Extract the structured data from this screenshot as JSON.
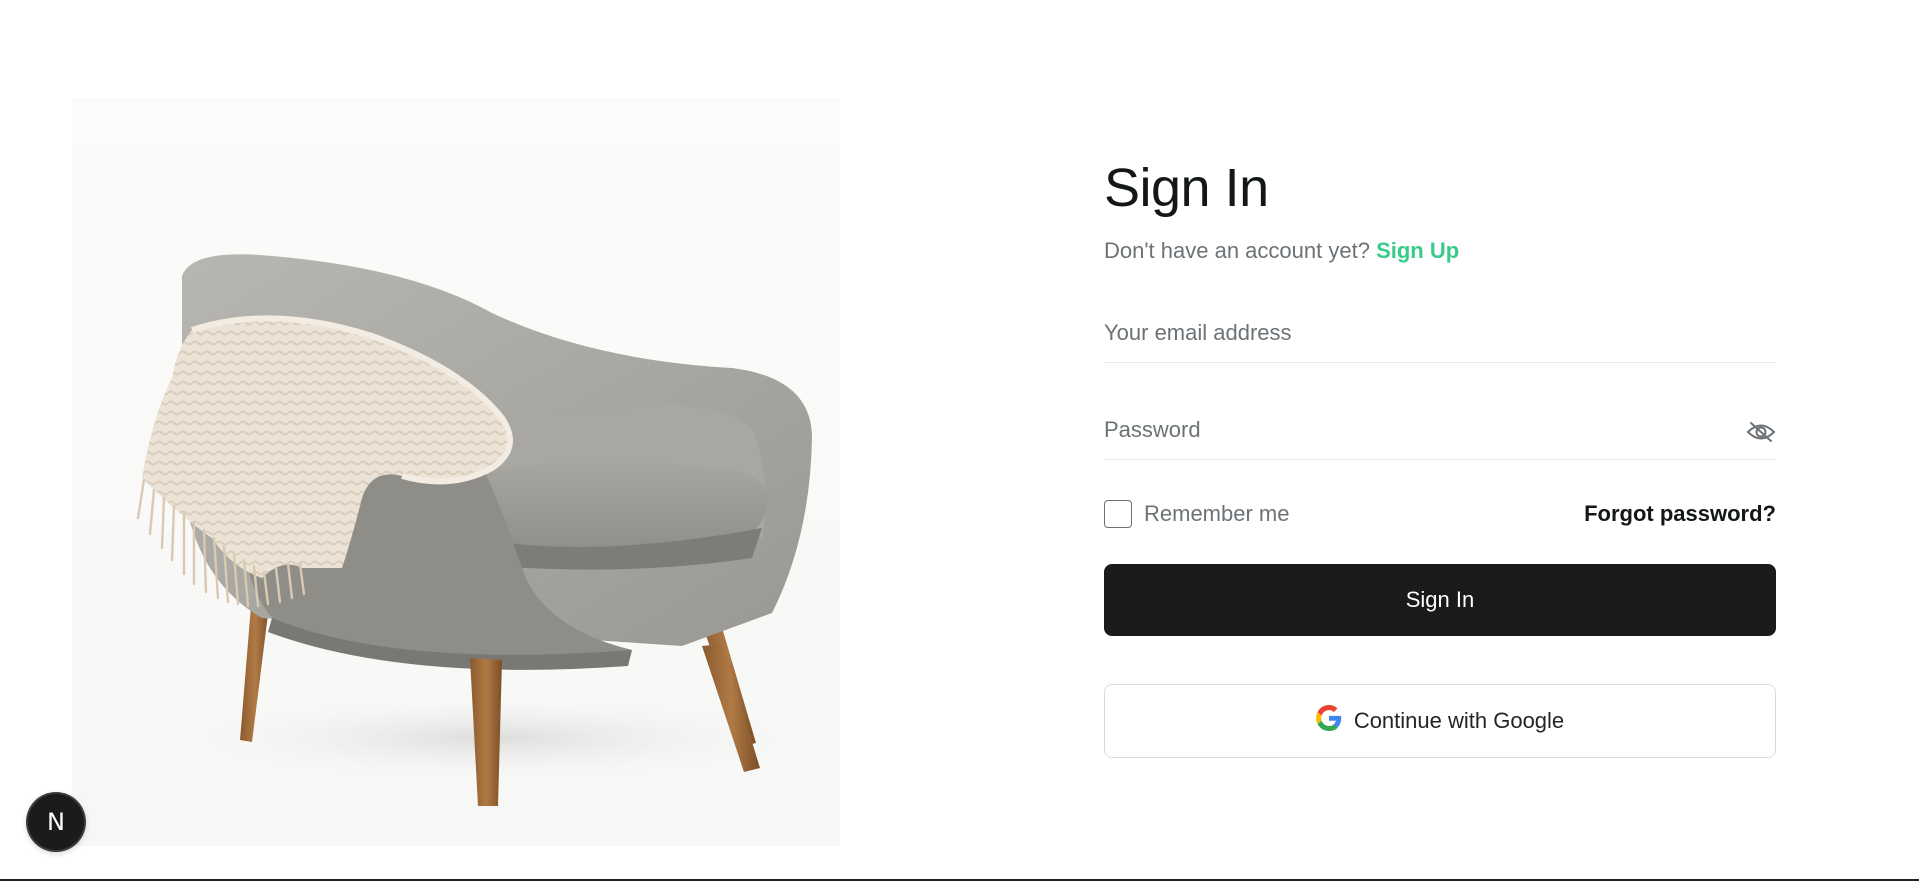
{
  "hero": {
    "image_label": "armchair with blanket"
  },
  "auth": {
    "title": "Sign In",
    "subtitle_prefix": "Don't have an account yet?",
    "signup_link": "Sign Up",
    "email": {
      "placeholder": "Your email address",
      "value": ""
    },
    "password": {
      "placeholder": "Password",
      "value": "",
      "toggle_icon": "eye-off-icon"
    },
    "remember_me": {
      "label": "Remember me",
      "checked": false
    },
    "forgot_password": "Forgot password?",
    "submit_label": "Sign In",
    "google_label": "Continue with Google",
    "google_icon": "google-g-icon"
  },
  "dev_badge": {
    "letter": "N",
    "icon": "nextjs-icon"
  },
  "colors": {
    "accent": "#38cb89",
    "primary_button": "#1a1a1a",
    "text_muted": "#6c7275",
    "text_dark": "#141718"
  }
}
